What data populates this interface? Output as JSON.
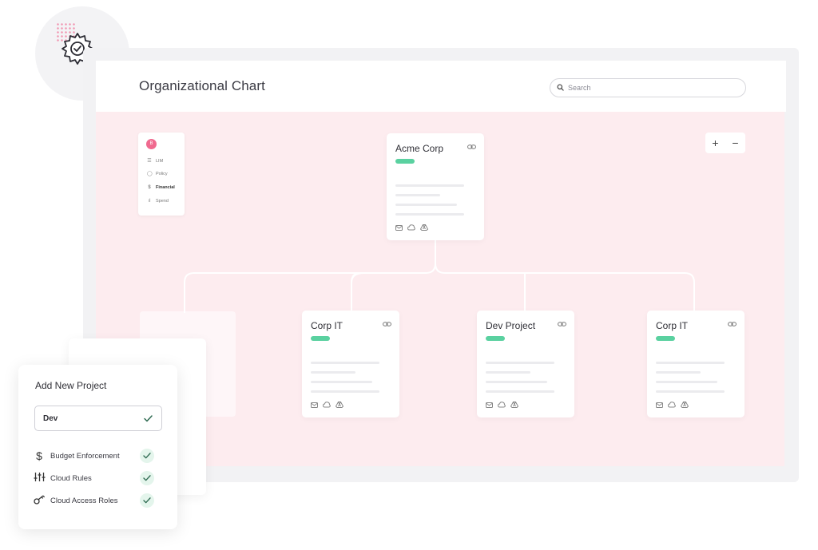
{
  "app": {
    "title": "Organizational Chart"
  },
  "search": {
    "placeholder": "Search",
    "icon": "search-icon"
  },
  "mini_nav": {
    "avatar": "B",
    "items": [
      {
        "label": "LIM",
        "icon": "list-icon"
      },
      {
        "label": "Policy",
        "icon": "shield-icon"
      },
      {
        "label": "Financial",
        "icon": "dollar-icon"
      },
      {
        "label": "Spend",
        "icon": "bar-chart-icon"
      }
    ]
  },
  "zoom": {
    "in_label": "+",
    "out_label": "−"
  },
  "org": {
    "root": {
      "title": "Acme Corp"
    },
    "children": [
      {
        "title": "Corp IT"
      },
      {
        "title": "Dev Project"
      },
      {
        "title": "Corp IT"
      }
    ]
  },
  "colors": {
    "accent": "#f06a8f",
    "tag_green": "#5ad1a0",
    "canvas_bg": "#fdecef"
  },
  "add_project": {
    "title": "Add New Project",
    "input_value": "Dev",
    "options": [
      {
        "label": "Budget Enforcement",
        "icon": "dollar-icon"
      },
      {
        "label": "Cloud Rules",
        "icon": "sliders-icon"
      },
      {
        "label": "Cloud Access Roles",
        "icon": "key-icon"
      }
    ]
  }
}
